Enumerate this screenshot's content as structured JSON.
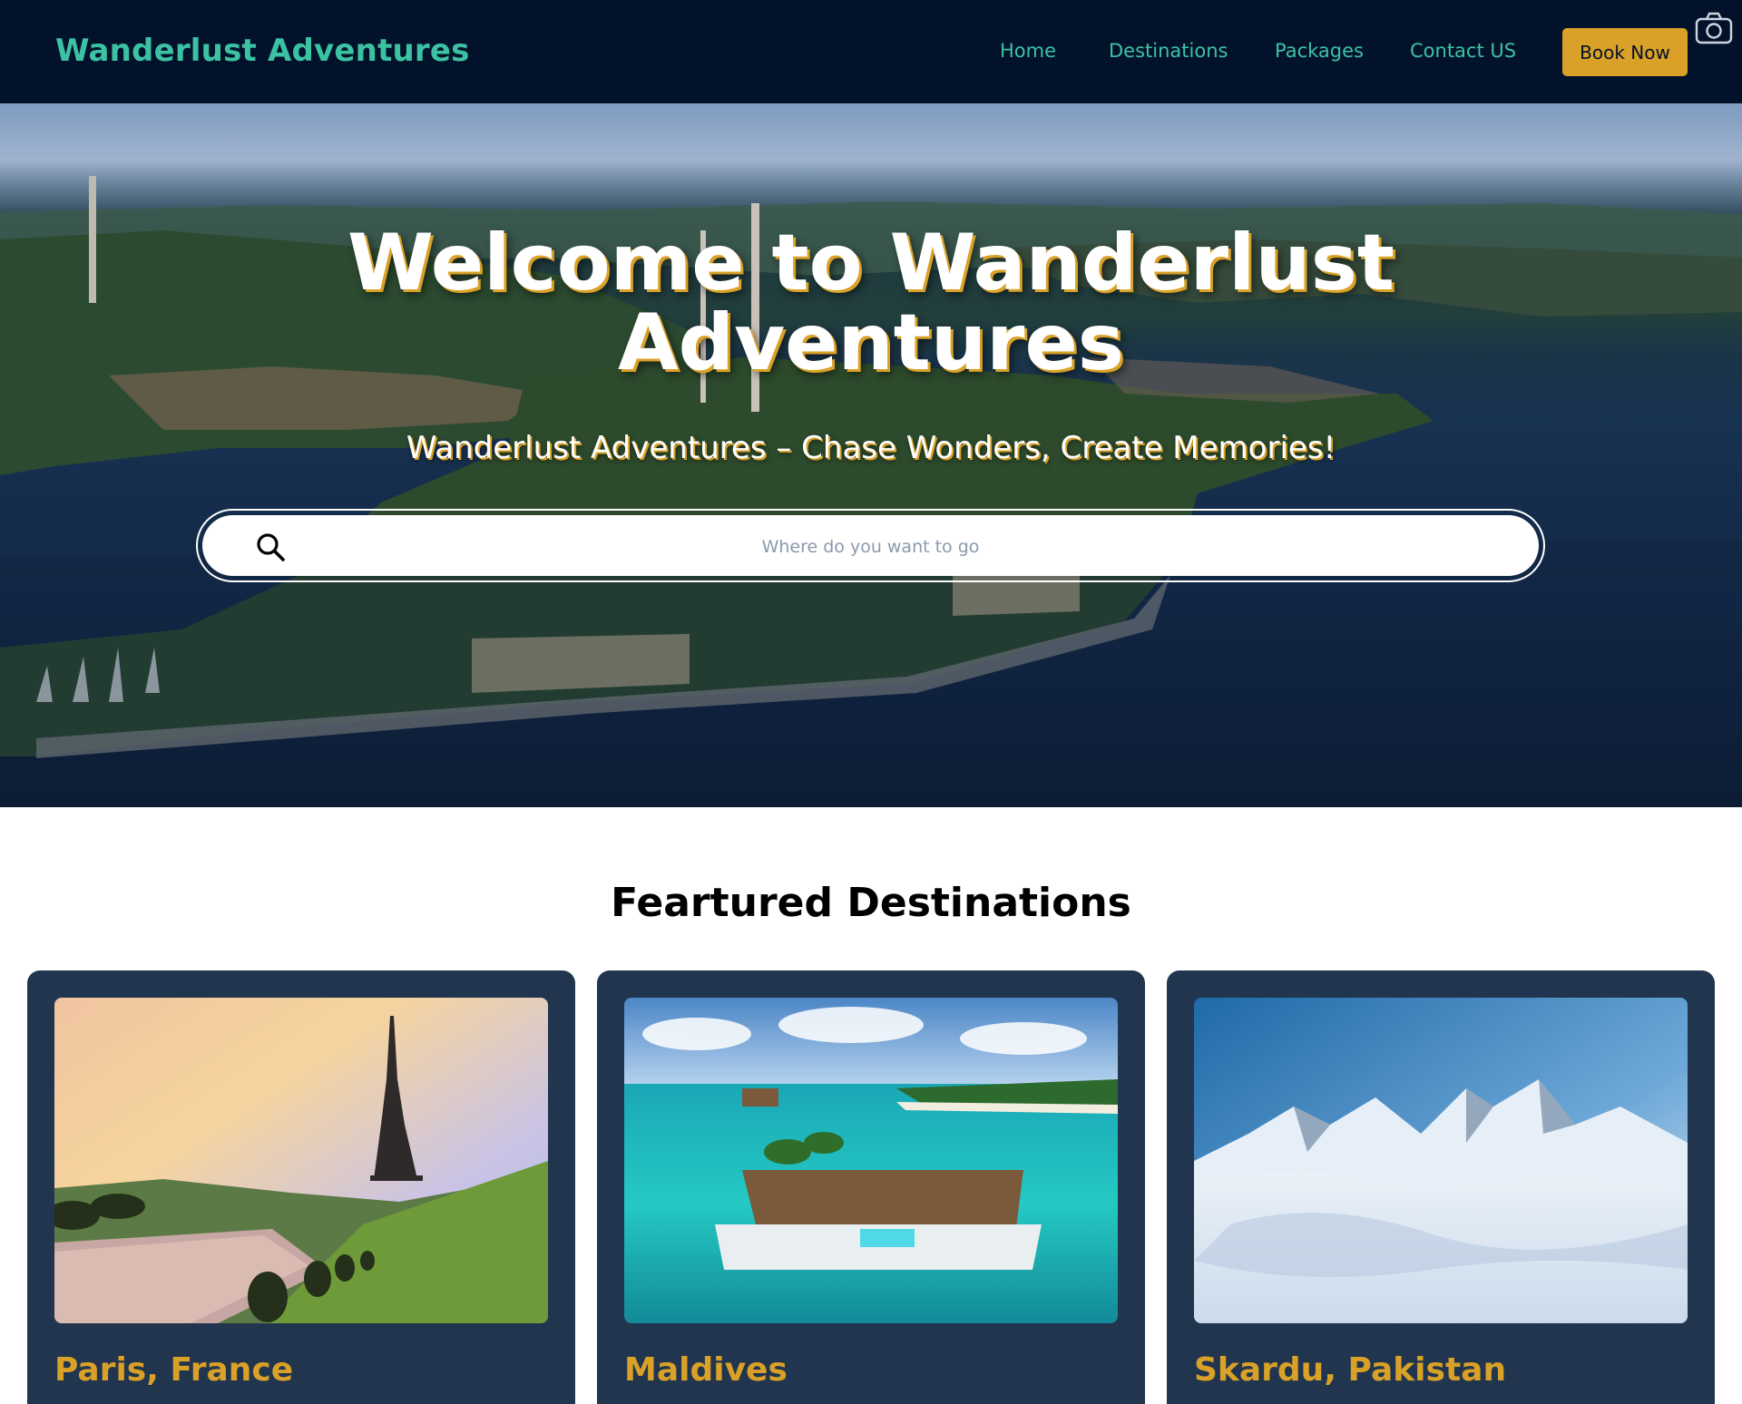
{
  "nav": {
    "brand": "Wanderlust Adventures",
    "links": [
      {
        "label": "Home"
      },
      {
        "label": "Destinations"
      },
      {
        "label": "Packages"
      },
      {
        "label": "Contact US"
      }
    ],
    "cta_label": "Book Now"
  },
  "hero": {
    "title_line1": "Welcome to Wanderlust",
    "title_line2": "Adventures",
    "subtitle": "Wanderlust Adventures – Chase Wonders, Create Memories!",
    "search": {
      "placeholder": "Where do you want to go",
      "value": ""
    }
  },
  "featured": {
    "title": "Feartured Destinations",
    "cards": [
      {
        "name": "Paris, France"
      },
      {
        "name": "Maldives"
      },
      {
        "name": "Skardu, Pakistan"
      }
    ]
  },
  "colors": {
    "nav_bg": "#03122b",
    "brand_accent": "#3cc2a2",
    "gold": "#d9a127",
    "card_bg": "#22354f"
  },
  "icons": [
    "camera-icon",
    "search-icon"
  ]
}
